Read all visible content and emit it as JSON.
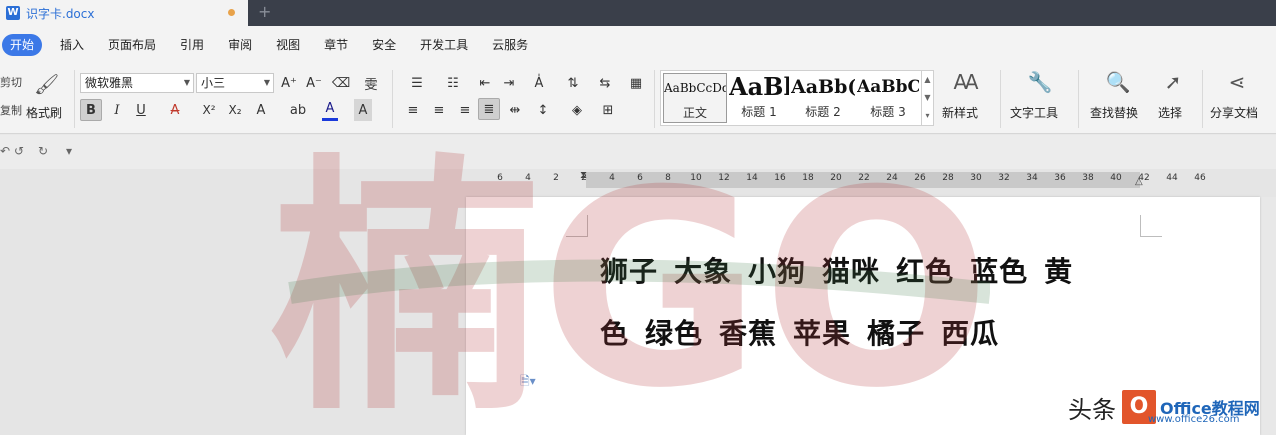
{
  "window": {
    "doc_tab_title": "识字卡.docx",
    "new_tab_symbol": "+"
  },
  "menu": {
    "items": [
      "开始",
      "插入",
      "页面布局",
      "引用",
      "审阅",
      "视图",
      "章节",
      "安全",
      "开发工具",
      "云服务"
    ],
    "active_index": 0
  },
  "ribbon": {
    "clipboard": {
      "cut_label": "剪切",
      "copy_label": "复制",
      "format_painter_label": "格式刷"
    },
    "font": {
      "family_value": "微软雅黑",
      "size_value": "小三",
      "grow_symbol": "A⁺",
      "shrink_symbol": "A⁻",
      "clear_symbol": "⌫",
      "phonetic_symbol": "雯",
      "bold_symbol": "B",
      "italic_symbol": "I",
      "underline_symbol": "U",
      "strike_symbol": "A",
      "superscript_symbol": "X²",
      "subscript_symbol": "X₂",
      "effect_symbol": "A",
      "highlight_symbol": "ab",
      "color_symbol": "A",
      "shade_symbol": "A"
    },
    "styles": [
      {
        "sample": "AaBbCcDd",
        "name": "正文"
      },
      {
        "sample": "AaBl",
        "name": "标题 1"
      },
      {
        "sample": "AaBb(",
        "name": "标题 2"
      },
      {
        "sample": "AaBbC",
        "name": "标题 3"
      }
    ],
    "new_style_label": "新样式",
    "text_tools_label": "文字工具",
    "find_replace_label": "查找替换",
    "select_label": "选择",
    "share_label": "分享文档"
  },
  "ruler": {
    "numbers": [
      "6",
      "4",
      "2",
      "2",
      "4",
      "6",
      "8",
      "10",
      "12",
      "14",
      "16",
      "18",
      "20",
      "22",
      "24",
      "26",
      "28",
      "30",
      "32",
      "34",
      "36",
      "38",
      "40",
      "42",
      "44",
      "46"
    ]
  },
  "document": {
    "line1": [
      "狮子",
      "大象",
      "小狗",
      "猫咪",
      "红色",
      "蓝色",
      "黄"
    ],
    "line2": [
      "色",
      "绿色",
      "香蕉",
      "苹果",
      "橘子",
      "西瓜"
    ]
  },
  "watermark": {
    "text": "楠GO"
  },
  "brand": {
    "toutiao_label": "头条",
    "logo_letter": "O",
    "office_label": "Office教程网",
    "site_label": "www.office26.com"
  },
  "colors": {
    "accent": "#3b78e7",
    "titlebar": "#3a3f4a",
    "ribbon_bg": "#f3f3f3",
    "watermark_red": "#b5393a",
    "watermark_green": "#3c7a45"
  }
}
